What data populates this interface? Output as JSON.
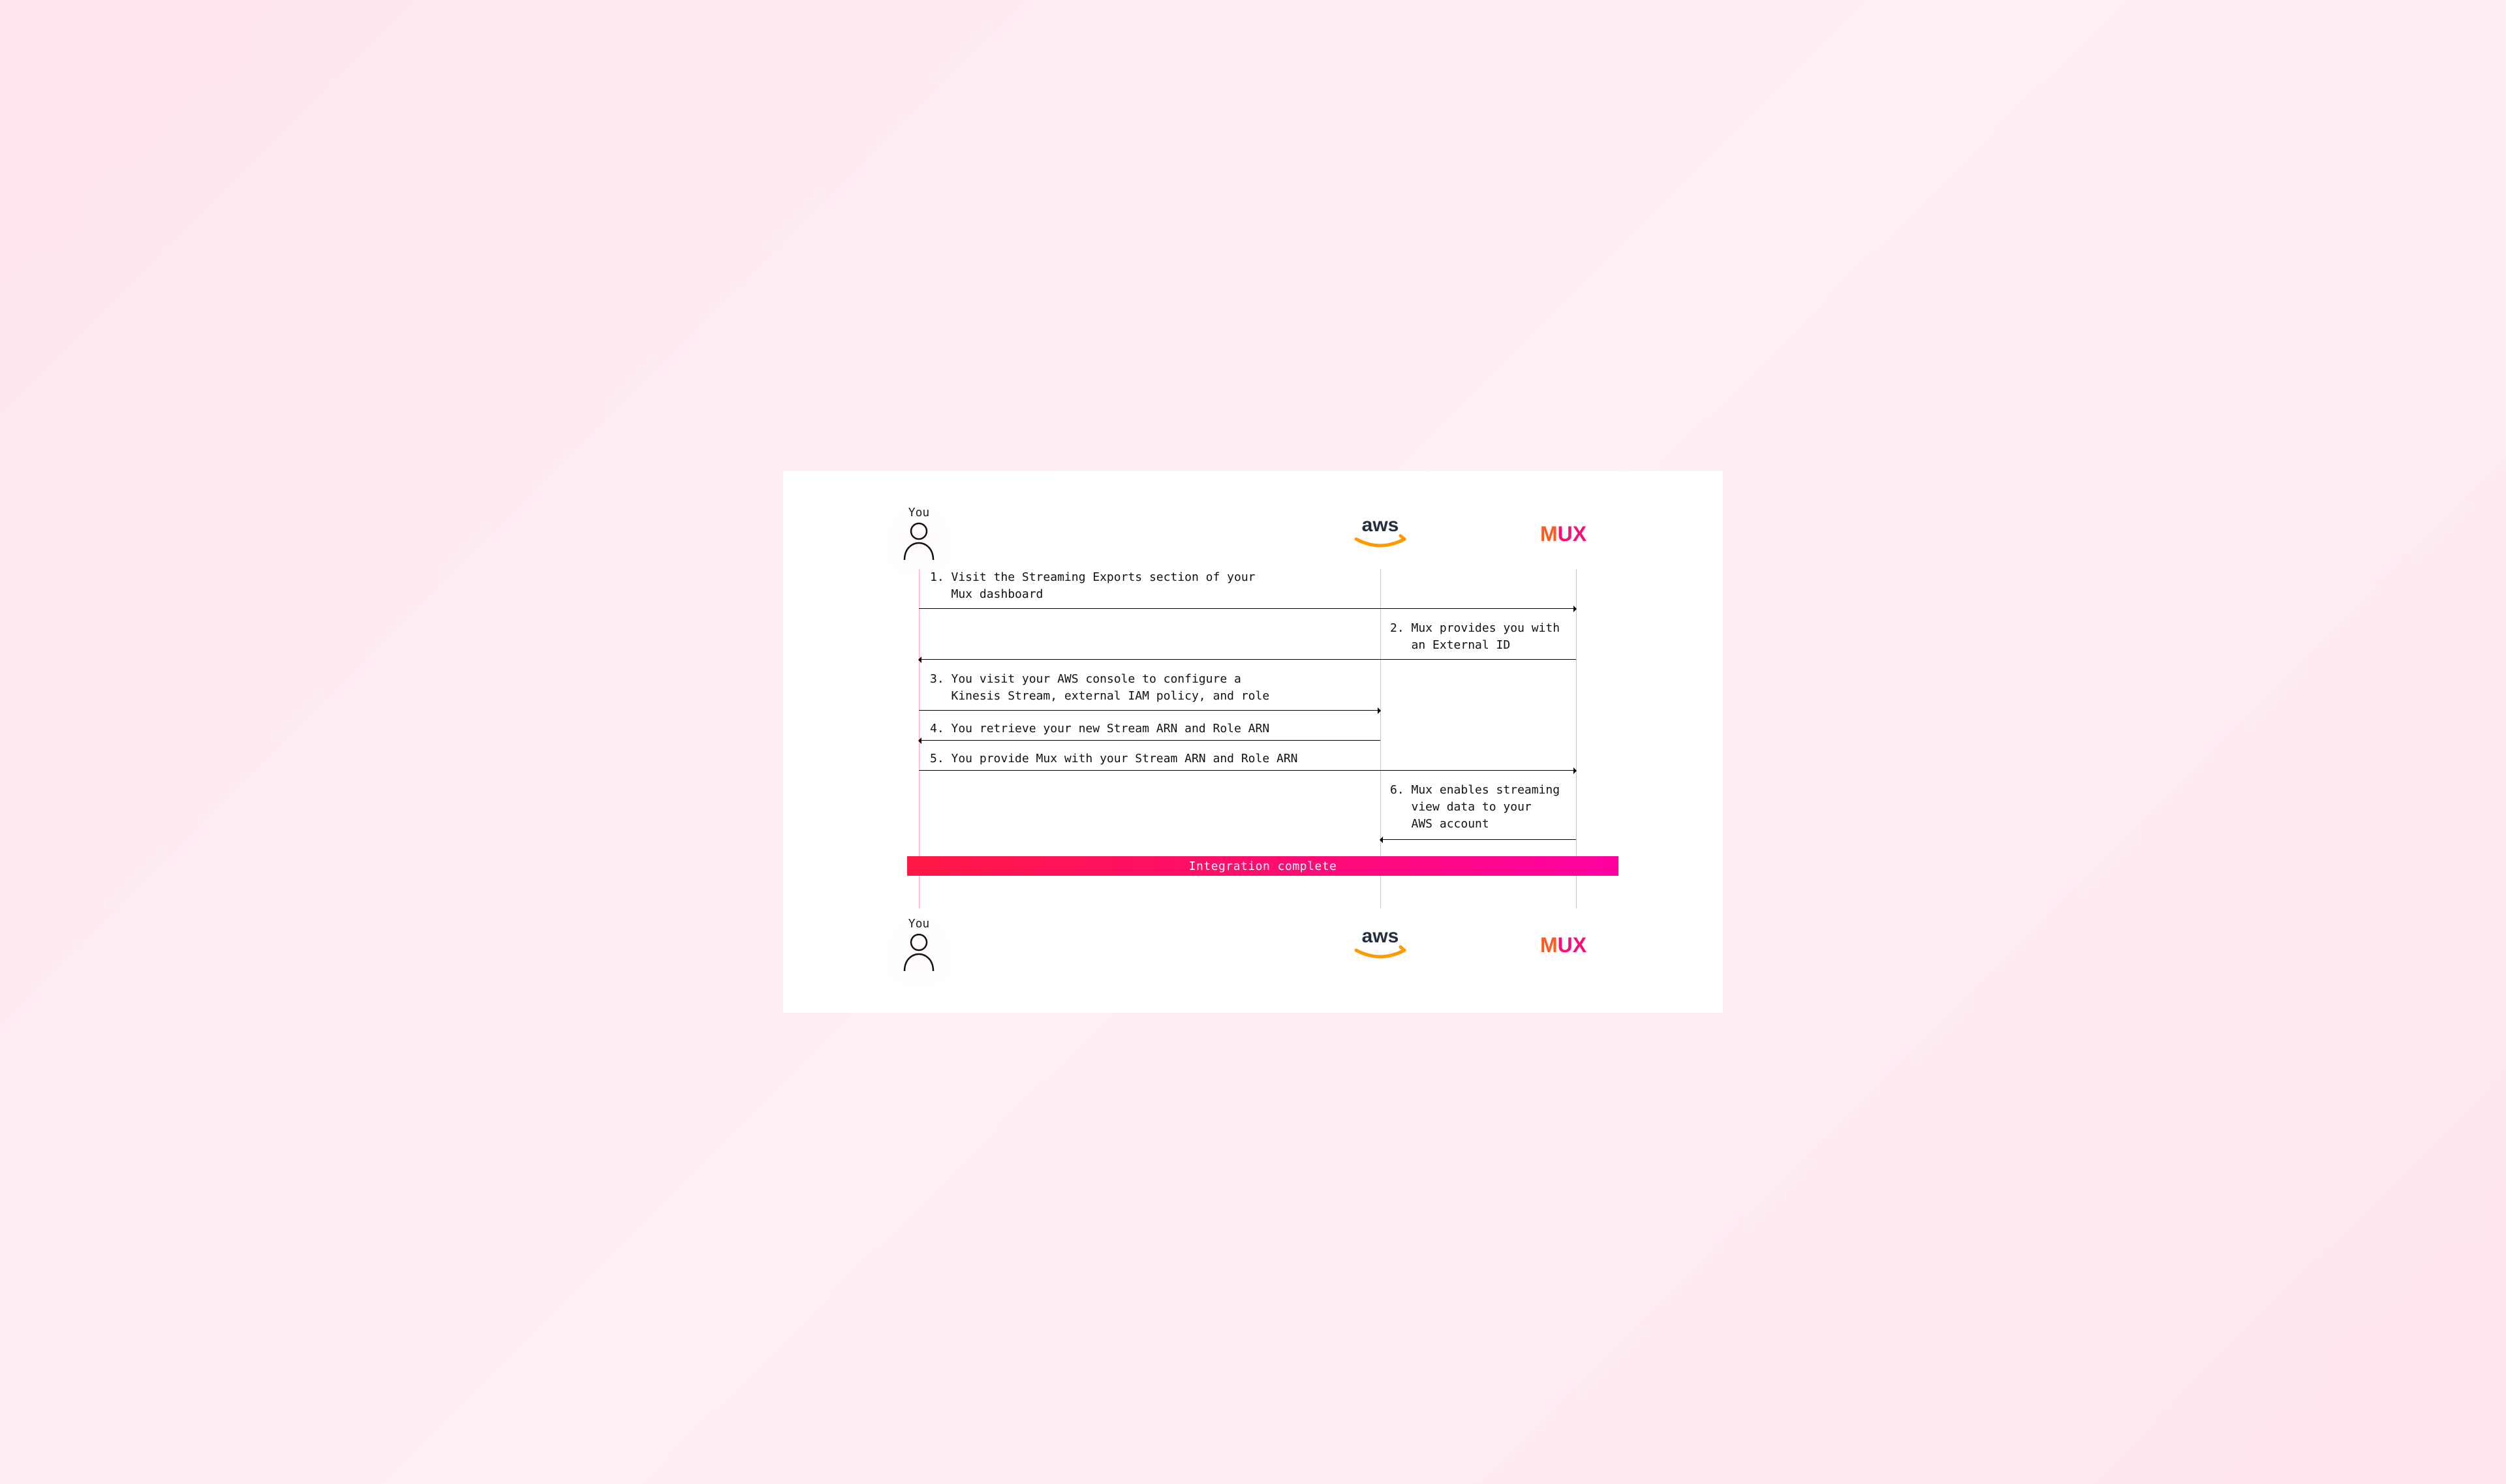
{
  "actors": {
    "you_label": "You",
    "aws_label": "aws",
    "mux_label": "MUX"
  },
  "steps": {
    "s1": "1. Visit the Streaming Exports section of your\n   Mux dashboard",
    "s2": "2. Mux provides you with\n   an External ID",
    "s3": "3. You visit your AWS console to configure a\n   Kinesis Stream, external IAM policy, and role",
    "s4": "4. You retrieve your new Stream ARN and Role ARN",
    "s5": "5. You provide Mux with your Stream ARN and Role ARN",
    "s6": "6. Mux enables streaming\n   view data to your\n   AWS account"
  },
  "banner": "Integration complete"
}
